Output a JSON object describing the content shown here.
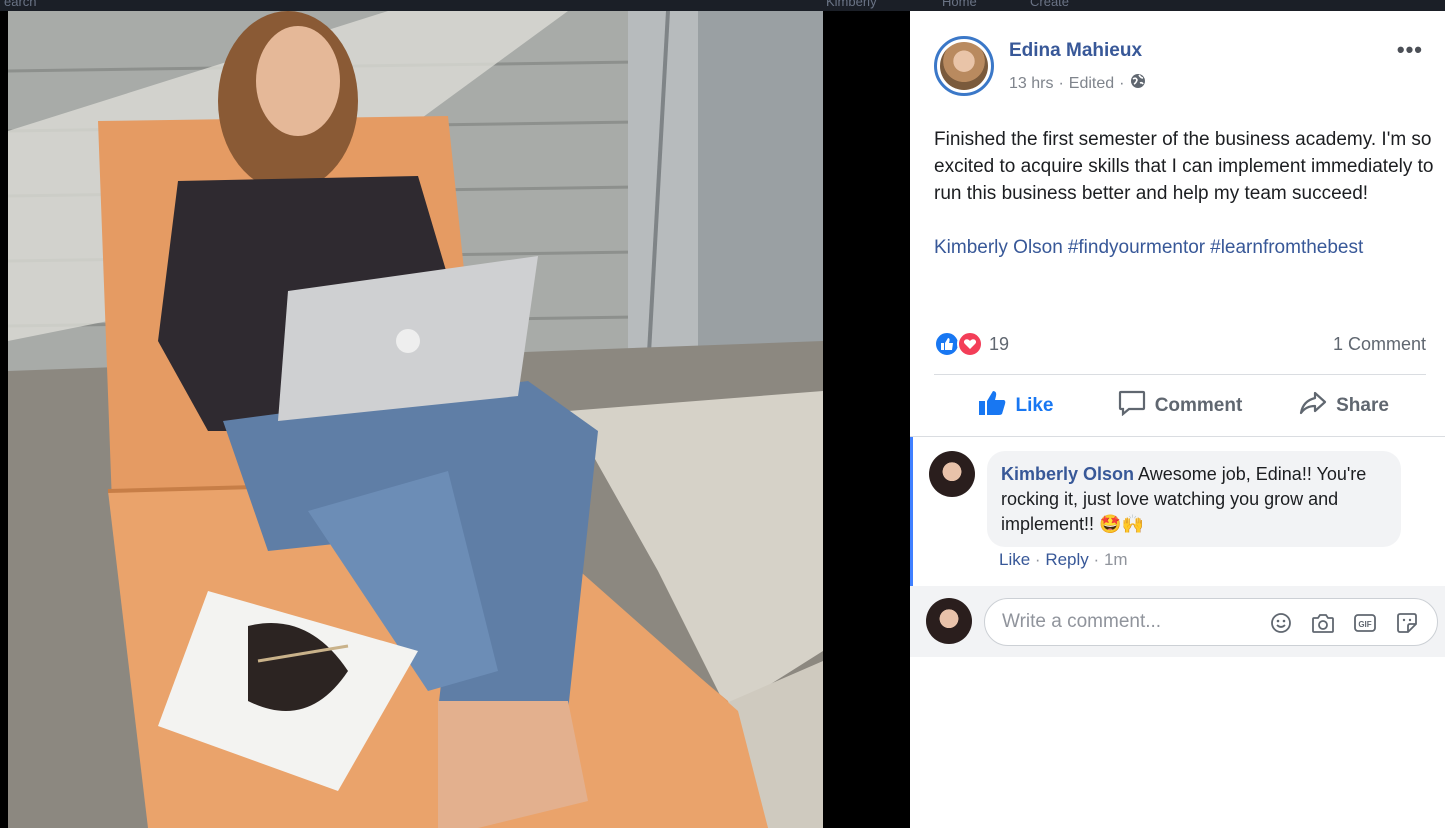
{
  "top_strip": {
    "left_text": "earch",
    "items": [
      "Kimberly",
      "Home",
      "Create"
    ]
  },
  "post": {
    "author": "Edina Mahieux",
    "time": "13 hrs",
    "edited": "Edited",
    "separator": "·",
    "more_label": "•••",
    "text": "Finished the first semester of the business academy. I'm so excited to acquire skills that I can implement immediately to run this business better and help my team succeed!",
    "mention": "Kimberly Olson",
    "hashtags": [
      "#findyourmentor",
      "#learnfromthebest"
    ],
    "reaction_count": "19",
    "comment_count": "1 Comment"
  },
  "actions": {
    "like": "Like",
    "comment": "Comment",
    "share": "Share"
  },
  "comment": {
    "author": "Kimberly Olson",
    "text": "Awesome job, Edina!! You're rocking it, just love watching you grow and implement!! 🤩🙌",
    "like": "Like",
    "reply": "Reply",
    "separator": "·",
    "time": "1m"
  },
  "composer": {
    "placeholder": "Write a comment..."
  },
  "icons": {
    "privacy": "globe-icon",
    "tools": [
      "emoji-icon",
      "camera-icon",
      "gif-icon",
      "sticker-icon"
    ]
  },
  "colors": {
    "brand_blue": "#385898",
    "like_blue": "#1877f2",
    "love_red": "#f33e58",
    "comment_border": "#4080ff"
  }
}
